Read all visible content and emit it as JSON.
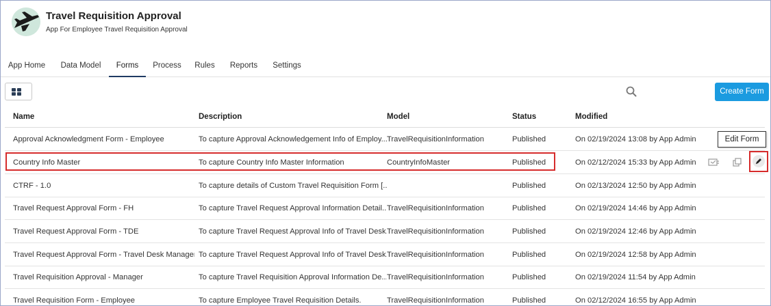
{
  "app": {
    "title": "Travel Requisition Approval",
    "subtitle": "App For Employee Travel Requisition Approval",
    "logo_icon": "airplane-icon"
  },
  "tabs": [
    {
      "label": "App Home",
      "active": false
    },
    {
      "label": "Data Model",
      "active": false
    },
    {
      "label": "Forms",
      "active": true
    },
    {
      "label": "Process",
      "active": false
    },
    {
      "label": "Rules",
      "active": false
    },
    {
      "label": "Reports",
      "active": false
    },
    {
      "label": "Settings",
      "active": false
    }
  ],
  "toolbar": {
    "view_toggle_icon": "grid-view-icon",
    "search_icon": "search-icon",
    "create_label": "Create Form"
  },
  "table": {
    "headers": {
      "name": "Name",
      "description": "Description",
      "model": "Model",
      "status": "Status",
      "modified": "Modified"
    },
    "rows": [
      {
        "name": "Approval Acknowledgment Form - Employee",
        "description": "To capture Approval Acknowledgement Info of Employ...",
        "model": "TravelRequisitionInformation",
        "status": "Published",
        "modified": "On 02/19/2024 13:08 by App Admin"
      },
      {
        "name": "Country Info Master",
        "description": "To capture Country Info Master Information",
        "model": "CountryInfoMaster",
        "status": "Published",
        "modified": "On 02/12/2024 15:33 by App Admin"
      },
      {
        "name": "CTRF - 1.0",
        "description": "To capture details of Custom Travel Requisition Form [...",
        "model": "",
        "status": "Published",
        "modified": "On 02/13/2024 12:50 by App Admin"
      },
      {
        "name": "Travel Request Approval Form - FH",
        "description": "To capture Travel Request Approval Information Detail...",
        "model": "TravelRequisitionInformation",
        "status": "Published",
        "modified": "On 02/19/2024 14:46 by App Admin"
      },
      {
        "name": "Travel Request Approval Form - TDE",
        "description": "To capture Travel Request Approval Info of Travel Desk...",
        "model": "TravelRequisitionInformation",
        "status": "Published",
        "modified": "On 02/19/2024 12:46 by App Admin"
      },
      {
        "name": "Travel Request Approval Form - Travel Desk Manager",
        "description": "To capture Travel Request Approval Info of Travel Desk...",
        "model": "TravelRequisitionInformation",
        "status": "Published",
        "modified": "On 02/19/2024 12:58 by App Admin"
      },
      {
        "name": "Travel Requisition Approval - Manager",
        "description": "To capture Travel Requisition Approval Information De...",
        "model": "TravelRequisitionInformation",
        "status": "Published",
        "modified": "On 02/19/2024 11:54 by App Admin"
      },
      {
        "name": "Travel Requisition Form - Employee",
        "description": "To capture Employee Travel Requisition Details.",
        "model": "TravelRequisitionInformation",
        "status": "Published",
        "modified": "On 02/12/2024 16:55 by App Admin"
      }
    ]
  },
  "row_actions": {
    "icons": [
      "preview-icon",
      "copy-icon",
      "edit-pencil-icon"
    ],
    "tooltip": "Edit Form"
  },
  "colors": {
    "accent": "#1b9be0",
    "highlight": "#d62b2b",
    "active_tab": "#1f3a63"
  }
}
